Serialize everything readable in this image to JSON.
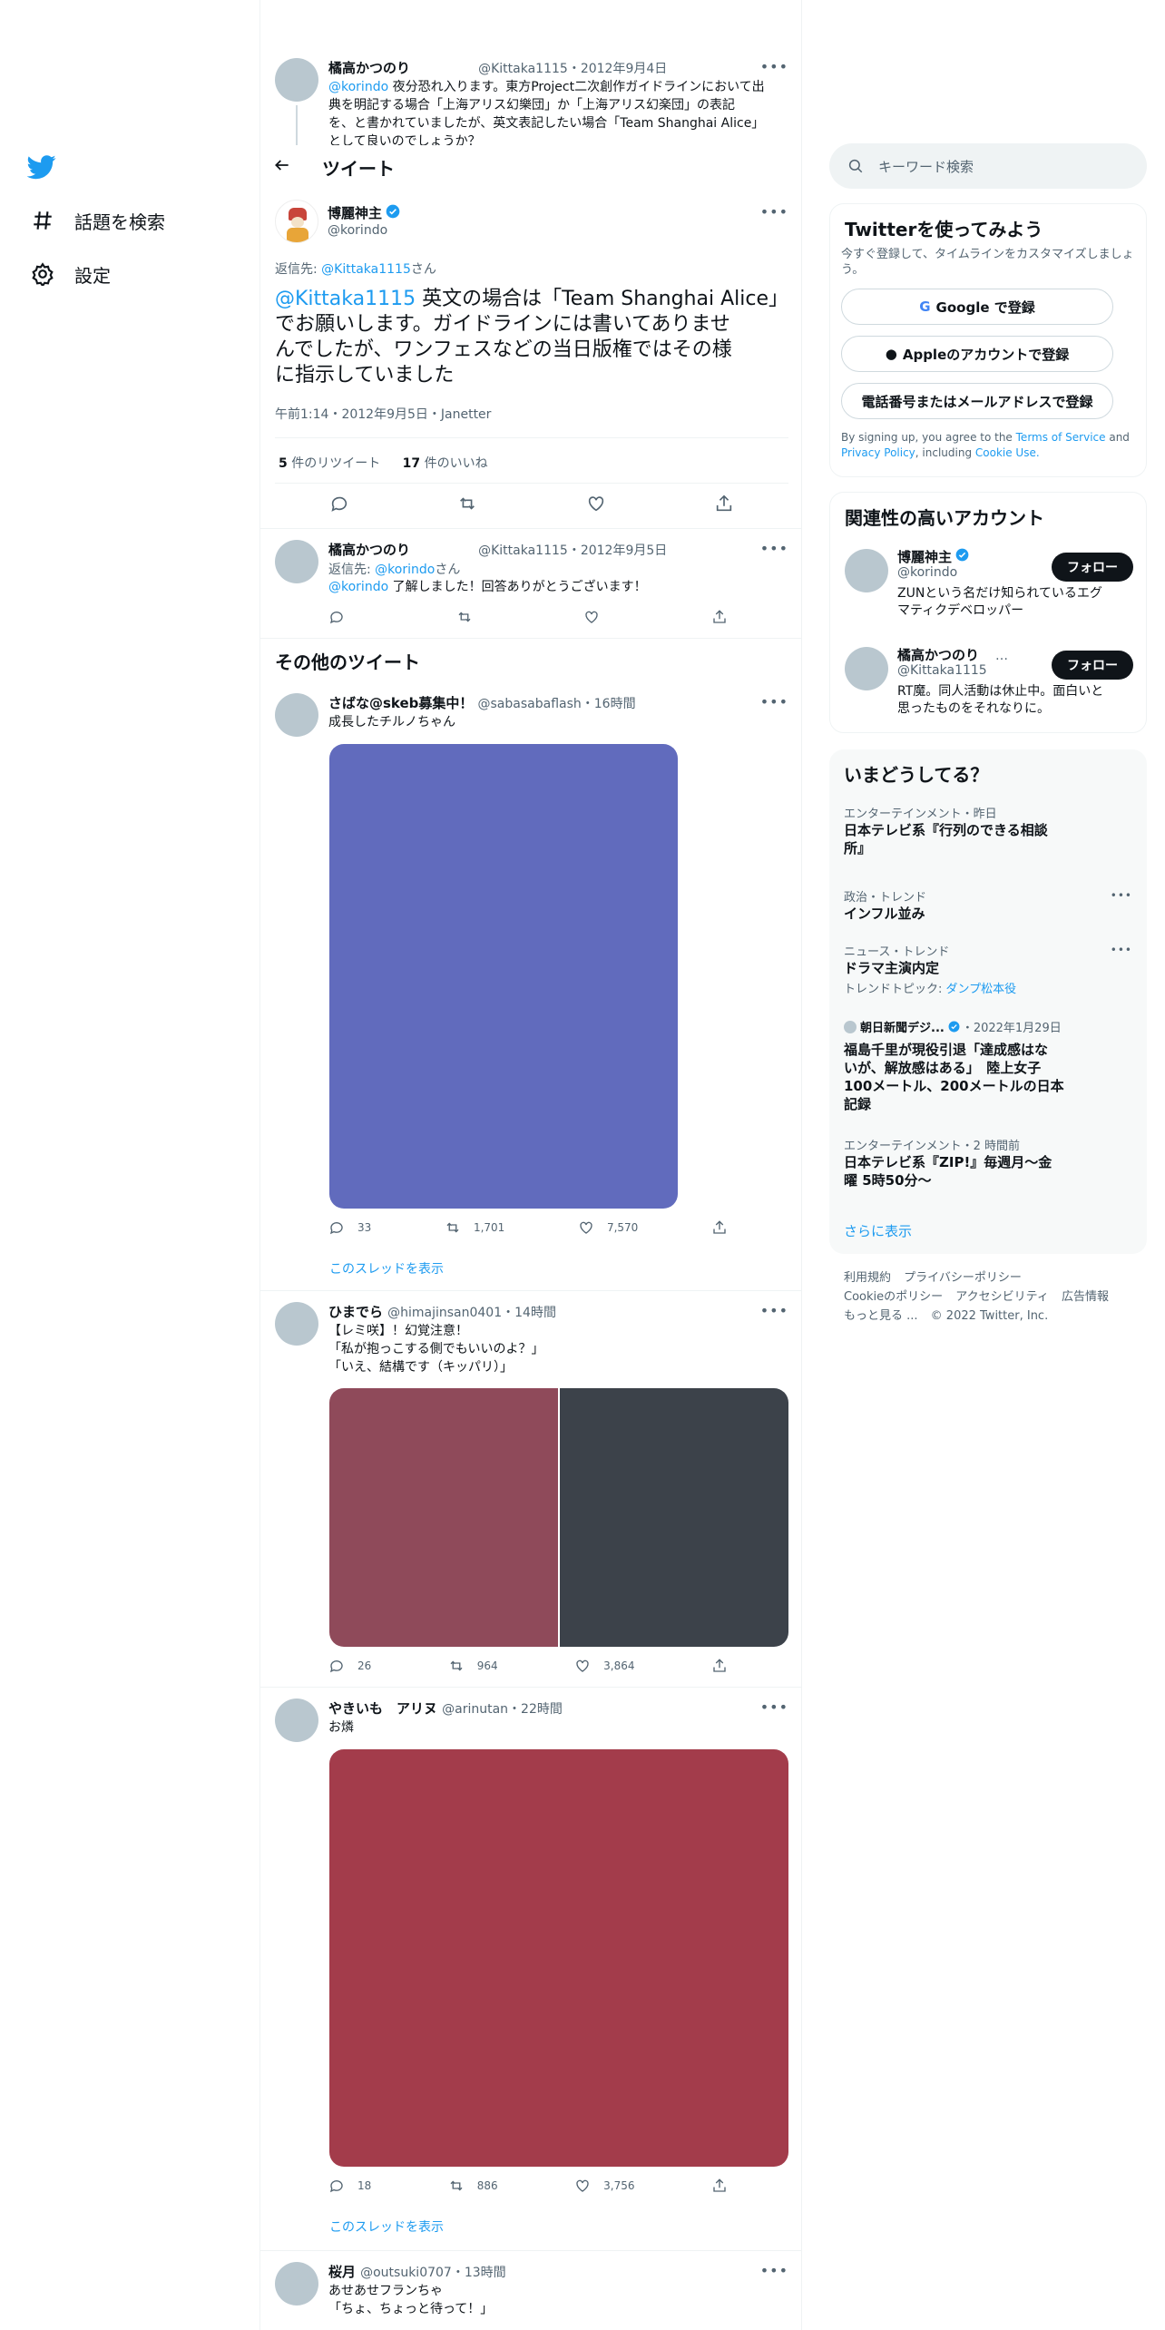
{
  "nav": {
    "explore": "話題を検索",
    "settings": "設定"
  },
  "header": {
    "title": "ツイート"
  },
  "parent_tweet": {
    "name": "橘高かつのり",
    "handle": "@Kittaka1115",
    "date": "2012年9月4日",
    "mention": "@korindo",
    "text1": " 夜分恐れ入ります。東方Project二次創作ガイドラインにおいて出",
    "text2": "典を明記する場合「上海アリス幻樂団」か「上海アリス幻楽団」の表記",
    "text3": "を、と書かれていましたが、英文表記したい場合「Team Shanghai Alice」",
    "text4": "として良いのでしょうか？"
  },
  "main_tweet": {
    "name": "博麗神主",
    "handle": "@korindo",
    "reply_prefix": "返信先: ",
    "reply_to": "@Kittaka1115",
    "reply_suffix": "さん",
    "mention": "@Kittaka1115",
    "text1": " 英文の場合は「Team Shanghai Alice」",
    "text2": "でお願いします。ガイドラインには書いてありませ",
    "text3": "んでしたが、ワンフェスなどの当日版権ではその様",
    "text4": "に指示していました",
    "timestamp": "午前1:14・2012年9月5日・Janetter",
    "retweets_count": "5",
    "retweets_label": " 件のリツイート",
    "likes_count": "17",
    "likes_label": " 件のいいね"
  },
  "reply_tweet": {
    "name": "橘高かつのり",
    "handle": "@Kittaka1115",
    "date": "2012年9月5日",
    "reply_prefix": "返信先: ",
    "reply_to": "@korindo",
    "reply_suffix": "さん",
    "mention": "@korindo",
    "text": " 了解しました！回答ありがとうございます！"
  },
  "more_tweets_heading": "その他のツイート",
  "feed": [
    {
      "name": "さばな@skeb募集中！",
      "handle": "@sabasabaflash",
      "time": "16時間",
      "text": "成長したチルノちゃん",
      "replies": "33",
      "retweets": "1,701",
      "likes": "7,570",
      "show_thread": "このスレッドを表示"
    },
    {
      "name": "ひまでら",
      "handle": "@himajinsan0401",
      "time": "14時間",
      "text1": "【レミ咲】！幻覚注意！",
      "text2": "「私が抱っこする側でもいいのよ？」",
      "text3": "「いえ、結構です（キッパリ）」",
      "replies": "26",
      "retweets": "964",
      "likes": "3,864"
    },
    {
      "name": "やきいも　アリヌ",
      "handle": "@arinutan",
      "time": "22時間",
      "text": "お燐",
      "replies": "18",
      "retweets": "886",
      "likes": "3,756",
      "show_thread": "このスレッドを表示"
    },
    {
      "name": "桜月",
      "handle": "@outsuki0707",
      "time": "13時間",
      "text1": "あせあせフランちゃ",
      "text2": "「ちょ、ちょっと待って！」"
    }
  ],
  "sidebar": {
    "search_placeholder": "キーワード検索",
    "signup": {
      "title": "Twitterを使ってみよう",
      "desc1": "今すぐ登録して、タイムラインをカスタマイズしましょ",
      "desc2": "う。",
      "google": "Google で登録",
      "apple": "Appleのアカウントで登録",
      "phone": "電話番号またはメールアドレスで登録",
      "terms1": "By signing up, you agree to the ",
      "terms_link": "Terms of Service",
      "terms2": " and",
      "privacy_link": "Privacy Policy",
      "terms3": ", including ",
      "cookie_link": "Cookie Use."
    },
    "related": {
      "title": "関連性の高いアカウント",
      "accounts": [
        {
          "name": "博麗神主",
          "handle": "@korindo",
          "bio1": "ZUNという名だけ知られているエグ",
          "bio2": "マティクデベロッパー",
          "follow": "フォロー"
        },
        {
          "name": "橘高かつのり",
          "handle": "@Kittaka1115",
          "bio1": "RT魔。同人活動は休止中。面白いと",
          "bio2": "思ったものをそれなりに。",
          "follow": "フォロー"
        }
      ]
    },
    "trends": {
      "title": "いまどうしてる？",
      "items": [
        {
          "cat": "エンターテインメント・昨日",
          "title1": "日本テレビ系『行列のできる相談",
          "title2": "所』"
        },
        {
          "cat": "政治・トレンド",
          "title1": "インフル並み"
        },
        {
          "cat": "ニュース・トレンド",
          "title1": "ドラマ主演内定",
          "topic_prefix": "トレンドトピック: ",
          "topic": "ダンプ松本役"
        },
        {
          "source": "朝日新聞デジ...",
          "date": "・2022年1月29日",
          "title1": "福島千里が現役引退「達成感はな",
          "title2": "いが、解放感はある」　陸上女子",
          "title3": "100メートル、200メートルの日本",
          "title4": "記録"
        },
        {
          "cat": "エンターテインメント・2 時間前",
          "title1": "日本テレビ系『ZIP!』毎週月〜金",
          "title2": "曜 5時50分〜"
        }
      ],
      "show_more": "さらに表示"
    },
    "footer": {
      "terms": "利用規約",
      "privacy": "プライバシーポリシー",
      "cookie": "Cookieのポリシー",
      "accessibility": "アクセシビリティ",
      "ads": "広告情報",
      "more": "もっと見る ...",
      "copyright": "© 2022 Twitter, Inc."
    }
  },
  "colors": {
    "accent": "#1d9bf0",
    "media1": "#616bbd",
    "media2a": "#8f4a5a",
    "media2b": "#3c424a",
    "media3": "#a33c4b"
  }
}
